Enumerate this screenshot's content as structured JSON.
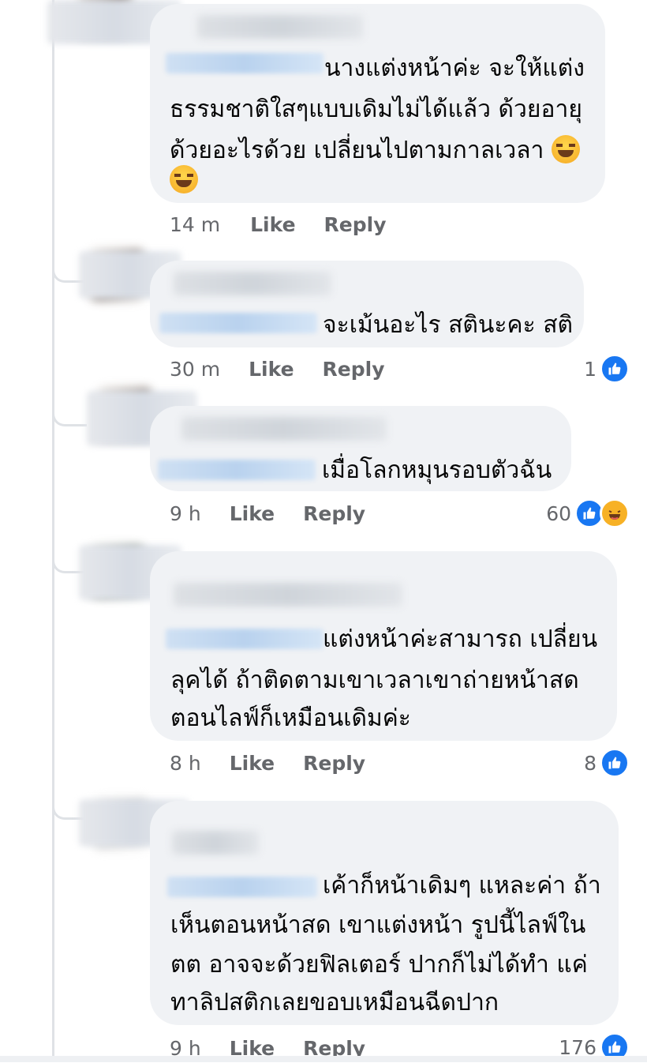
{
  "comments": [
    {
      "lines": [
        "นางแต่งหน้าค่ะ จะให้แต่ง",
        "ธรรมชาติใสๆแบบเดิมไม่ได้แล้ว ด้วยอายุ",
        "ด้วยอะไรด้วย เปลี่ยนไปตามกาลเวลา"
      ],
      "time": "14 m",
      "like_label": "Like",
      "reply_label": "Reply",
      "reactions": ""
    },
    {
      "lines": [
        "จะเม้นอะไร สตินะคะ สติ"
      ],
      "time": "30 m",
      "like_label": "Like",
      "reply_label": "Reply",
      "reactions": "1"
    },
    {
      "lines": [
        "เมื่อโลกหมุนรอบตัวฉัน"
      ],
      "time": "9 h",
      "like_label": "Like",
      "reply_label": "Reply",
      "reactions": "60"
    },
    {
      "lines": [
        "แต่งหน้าค่ะสามารถ เปลี่ยน",
        "ลุคได้ ถ้าติดตามเขาเวลาเขาถ่ายหน้าสด",
        "ตอนไลฟ์ก็เหมือนเดิมค่ะ"
      ],
      "time": "8 h",
      "like_label": "Like",
      "reply_label": "Reply",
      "reactions": "8"
    },
    {
      "lines": [
        "เค้าก็หน้าเดิมๆ แหละค่า ถ้า",
        "เห็นตอนหน้าสด เขาแต่งหน้า รูปนี้ไลฟ์ใน",
        "ตต อาจจะด้วยฟิลเตอร์ ปากก็ไม่ได้ทำ แค่",
        "ทาลิปสติกเลยขอบเหมือนฉีดปาก"
      ],
      "time": "9 h",
      "like_label": "Like",
      "reply_label": "Reply",
      "reactions": "176"
    }
  ],
  "icons": {
    "like": "thumbs-up-icon",
    "haha": "laughing-face-icon",
    "tears_of_joy": "face-with-tears-of-joy-icon"
  },
  "colors": {
    "like_blue": "#1877f2",
    "bubble_bg": "#f0f2f5",
    "meta_gray": "#65676b"
  }
}
